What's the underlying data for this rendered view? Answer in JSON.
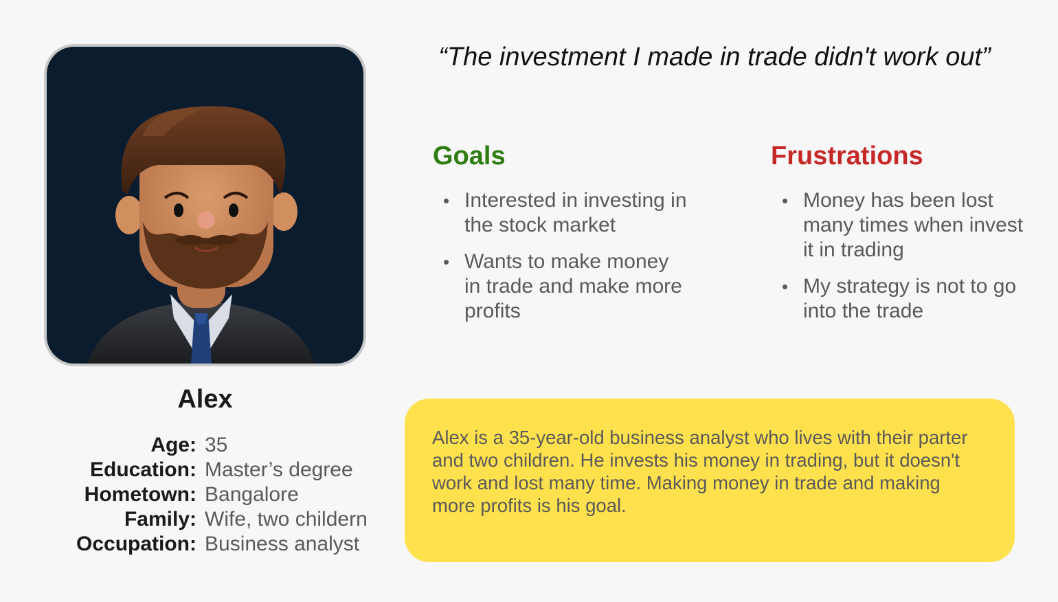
{
  "quote": "“The investment I made in trade didn't work out”",
  "persona": {
    "name": "Alex",
    "details": [
      {
        "label": "Age:",
        "value": "35"
      },
      {
        "label": "Education:",
        "value": "Master’s degree"
      },
      {
        "label": "Hometown:",
        "value": "Bangalore"
      },
      {
        "label": "Family:",
        "value": "Wife, two childern"
      },
      {
        "label": "Occupation:",
        "value": "Business analyst"
      }
    ]
  },
  "goals": {
    "title": "Goals",
    "items": [
      "Interested in investing in the stock market",
      "Wants to make money in trade and make more profits"
    ]
  },
  "frustrations": {
    "title": "Frustrations",
    "items": [
      "Money has been lost many times when invest it in trading",
      "My strategy is not to go into the trade"
    ]
  },
  "bio": "Alex is a 35-year-old business analyst who lives with their parter and two children. He invests his money in trading, but it doesn't work and lost many time. Making money in trade and making more profits is his goal.",
  "bullet_glyph": "•",
  "icons": {
    "avatar": "avatar-3d-bearded-man-icon"
  },
  "colors": {
    "background": "#f7f7f7",
    "avatar_background": "#0b1c2e",
    "goals_title": "#2e7d12",
    "frustrations_title": "#c62828",
    "bio_box": "#ffe14d",
    "body_text": "#595959",
    "heading_text": "#1a1a1a"
  }
}
